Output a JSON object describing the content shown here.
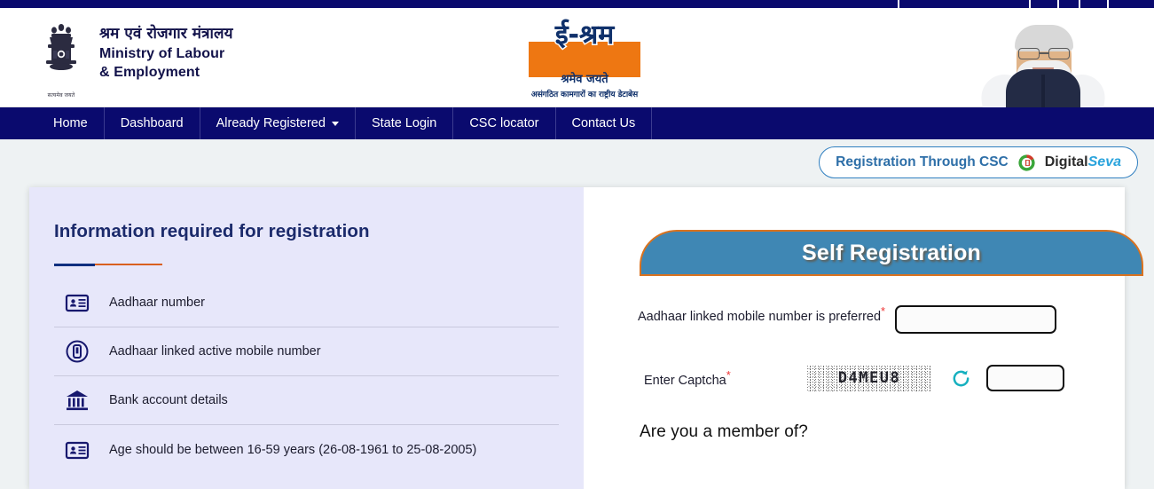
{
  "topbar": {
    "separators": [
      12,
      160,
      192,
      216,
      248
    ]
  },
  "header": {
    "emblem": {
      "name": "national-emblem",
      "motto": "सत्यमेव जयते"
    },
    "ministry": {
      "hindi": "श्रम एवं रोजगार मंत्रालय",
      "english_line1": "Ministry of Labour",
      "english_line2": "& Employment"
    },
    "logo": {
      "name": "eshram-logo",
      "word": "ई-श्रम",
      "subtitle": "श्रमेव जयते",
      "tagline": "असंगठित कामगारों का राष्ट्रीय डेटाबेस"
    },
    "portrait": {
      "name": "prime-minister-portrait"
    }
  },
  "nav": {
    "items": [
      {
        "label": "Home",
        "has_caret": false
      },
      {
        "label": "Dashboard",
        "has_caret": false
      },
      {
        "label": "Already Registered",
        "has_caret": true
      },
      {
        "label": "State Login",
        "has_caret": false
      },
      {
        "label": "CSC locator",
        "has_caret": false
      },
      {
        "label": "Contact Us",
        "has_caret": false
      }
    ]
  },
  "csc": {
    "label": "Registration Through CSC",
    "brand_bold": "Digital",
    "brand_italic": "Seva"
  },
  "left_panel": {
    "title": "Information required for registration",
    "items": [
      {
        "icon": "id-card-icon",
        "label": "Aadhaar number"
      },
      {
        "icon": "mobile-phone-icon",
        "label": "Aadhaar linked active mobile number"
      },
      {
        "icon": "bank-icon",
        "label": "Bank account details"
      },
      {
        "icon": "id-card-icon",
        "label": "Age should be between 16-59 years (26-08-1961 to 25-08-2005)"
      }
    ]
  },
  "right_panel": {
    "banner_title": "Self Registration",
    "mobile_field": {
      "label": "Aadhaar linked mobile number is preferred",
      "required_mark": "*",
      "value": "",
      "placeholder": ""
    },
    "captcha_field": {
      "label": "Enter Captcha",
      "required_mark": "*",
      "code": "D4MEU8",
      "refresh_icon": "refresh-icon",
      "value": "",
      "placeholder": ""
    },
    "member_question": "Are you a member of?"
  },
  "colors": {
    "navy": "#0a0a6e",
    "orange": "#d9721f",
    "banner_blue": "#3f87b4",
    "panel_lavender": "#e7e7fa",
    "teal": "#16b0bf",
    "csc_blue": "#2e6fa8"
  }
}
